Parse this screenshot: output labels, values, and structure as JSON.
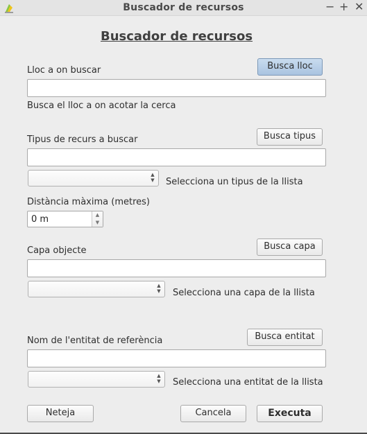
{
  "window": {
    "title": "Buscador de recursos",
    "controls": {
      "minimize": "−",
      "maximize": "+",
      "close": "✕"
    }
  },
  "heading": "Buscador de recursos",
  "location": {
    "label": "Lloc a on buscar",
    "button": "Busca lloc",
    "value": "",
    "hint": "Busca el lloc a on acotar la cerca"
  },
  "resource_type": {
    "label": "Tipus de recurs a buscar",
    "button": "Busca tipus",
    "value": "",
    "combo_value": "",
    "combo_hint": "Selecciona un tipus de la llista"
  },
  "distance": {
    "label": "Distància màxima (metres)",
    "value": "0 m"
  },
  "layer": {
    "label": "Capa objecte",
    "button": "Busca capa",
    "value": "",
    "combo_value": "",
    "combo_hint": "Selecciona una capa de la llista"
  },
  "entity": {
    "label": "Nom de l'entitat de referència",
    "button": "Busca entitat",
    "value": "",
    "combo_value": "",
    "combo_hint": "Selecciona una entitat de la llista"
  },
  "footer": {
    "clear": "Neteja",
    "cancel": "Cancela",
    "execute": "Executa"
  },
  "colors": {
    "background": "#ededed",
    "active_button": "#b6cde6",
    "text": "#2e2e2e"
  }
}
